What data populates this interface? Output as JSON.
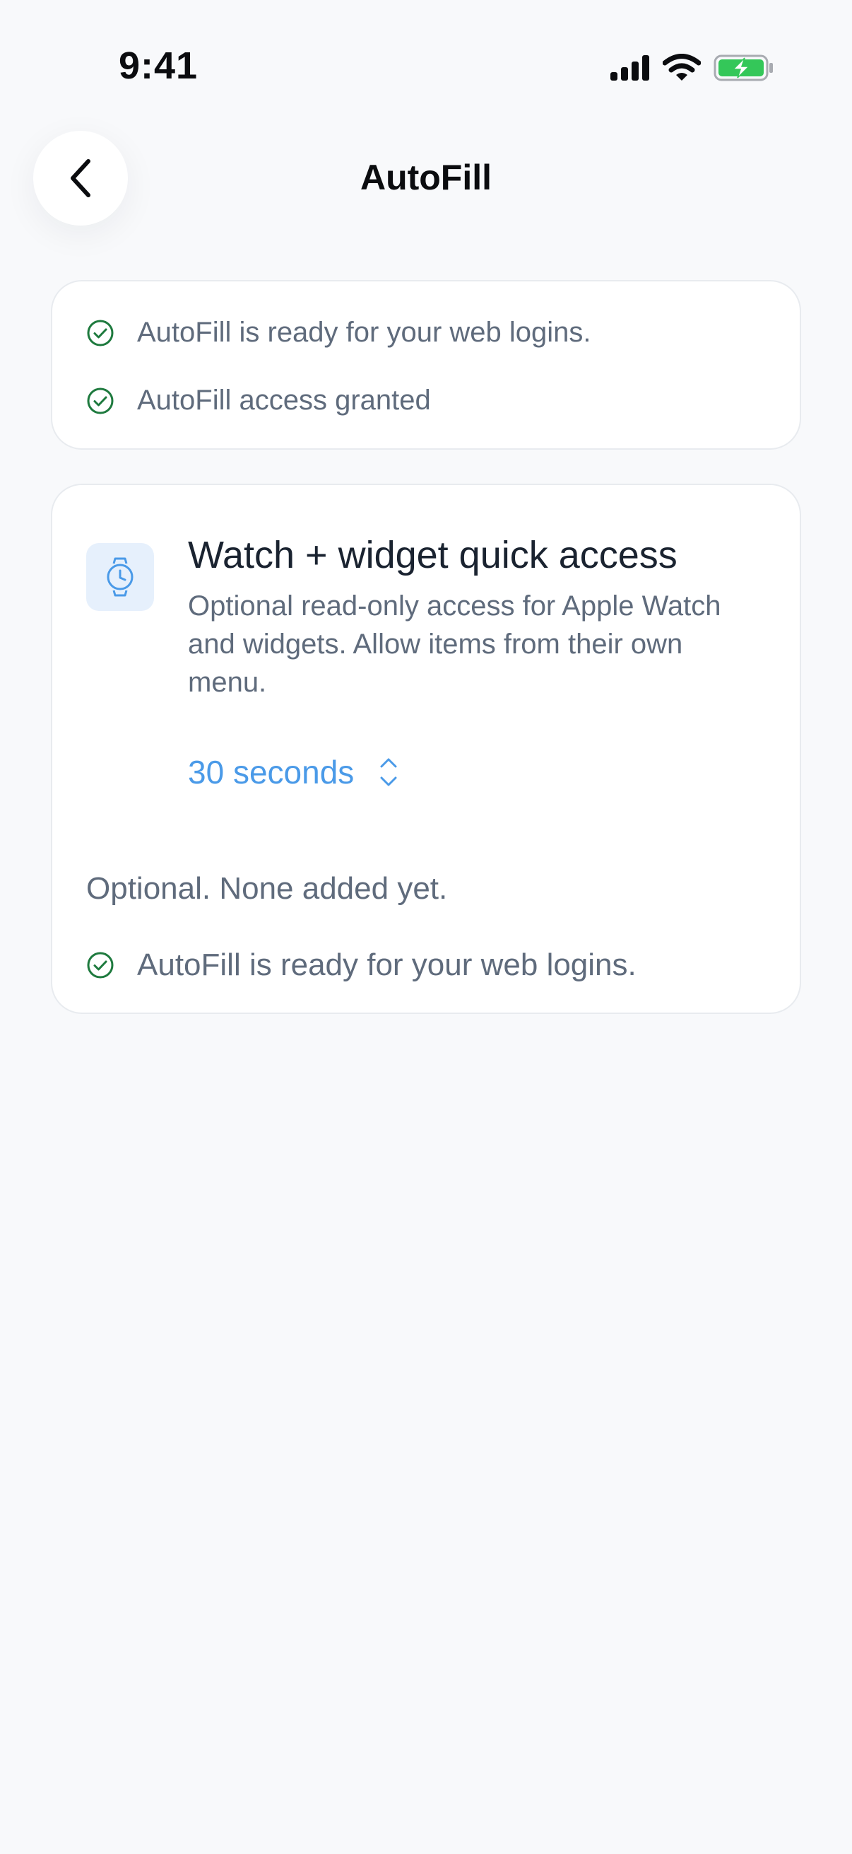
{
  "status_bar": {
    "time": "9:41",
    "icons": [
      "cellular-signal-icon",
      "wifi-icon",
      "battery-charging-icon"
    ],
    "battery_color": "#34c759"
  },
  "header": {
    "title": "AutoFill",
    "back_icon": "chevron-left-icon"
  },
  "status_card": {
    "items": [
      {
        "text": "AutoFill is ready for your web logins.",
        "icon": "check-circle-icon"
      },
      {
        "text": "AutoFill access granted",
        "icon": "check-circle-icon"
      }
    ]
  },
  "watch_card": {
    "icon": "watch-icon",
    "title": "Watch + widget quick access",
    "description": "Optional read-only access for Apple Watch and widgets. Allow items from their own menu.",
    "duration": {
      "value": "30 seconds",
      "icon": "chevron-up-down-icon"
    },
    "optional_note": "Optional. None added yet.",
    "status": {
      "text": "AutoFill is ready for your web logins.",
      "icon": "check-circle-icon"
    }
  },
  "colors": {
    "background": "#f8f9fb",
    "accent": "#4a9ae8",
    "success": "#1e7a3e",
    "text_primary": "#1a2330",
    "text_secondary": "#5f6b7c"
  }
}
